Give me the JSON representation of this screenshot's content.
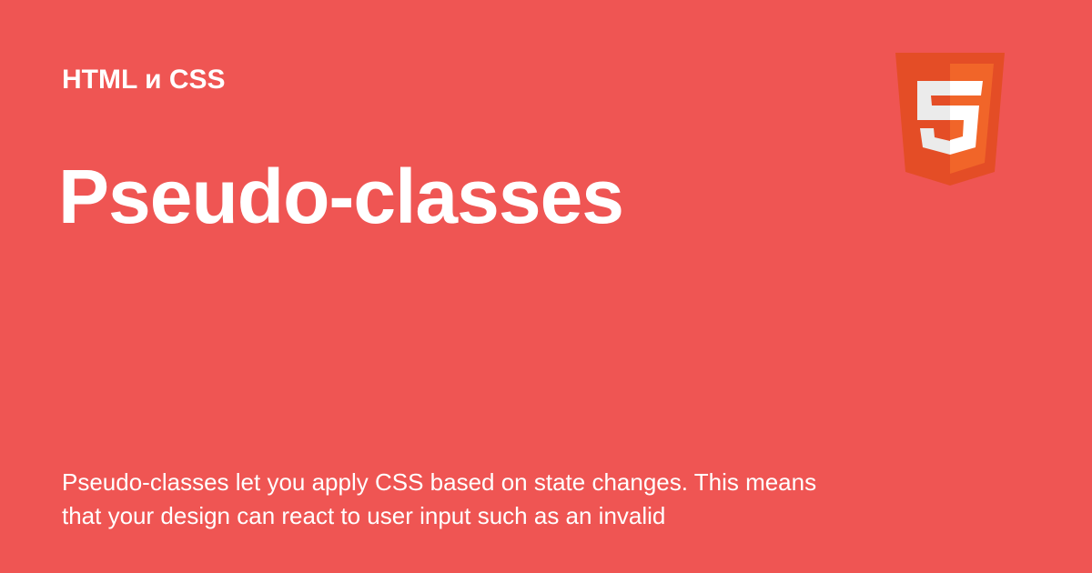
{
  "card": {
    "category": "HTML и CSS",
    "title": "Pseudo-classes",
    "description": "Pseudo-classes let you apply CSS based on state changes. This means that your design can react to user input such as an invalid"
  },
  "logo": {
    "icon": "html5-icon",
    "colors": {
      "outer": "#e44d26",
      "inner": "#f16529",
      "glyph": "#ebebeb",
      "glyph_light": "#ffffff"
    }
  },
  "theme": {
    "background": "#ef5553",
    "text": "#ffffff"
  }
}
